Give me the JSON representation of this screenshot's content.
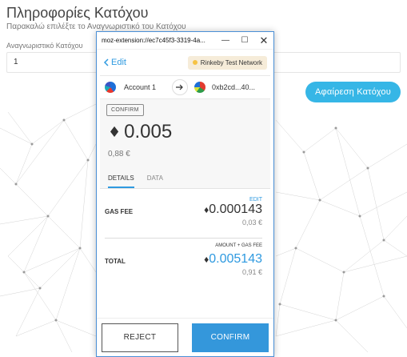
{
  "page": {
    "title": "Πληροφορίες Κατόχου",
    "subtitle": "Παρακαλώ επιλέξτε το Αναγνωριστικό του Κατόχου",
    "field_label": "Αναγνωριστικό Κατόχου",
    "field_value": "1",
    "remove_button": "Αφαίρεση Κατόχου"
  },
  "popup": {
    "window_title": "moz-extension://ec7c45f3-3319-4a...",
    "window_controls": {
      "minimize": "—",
      "maximize": "☐",
      "close": "✕"
    },
    "back_label": "Edit",
    "network": "Rinkeby Test Network",
    "from_account": "Account 1",
    "to_address": "0xb2cd...40...",
    "badge": "CONFIRM",
    "eth_symbol": "♦",
    "amount": "0.005",
    "amount_fiat": "0,88 €",
    "tabs": [
      "DETAILS",
      "DATA"
    ],
    "edit_small": "EDIT",
    "gas_fee_label": "GAS FEE",
    "gas_fee_value": "0.000143",
    "gas_fee_fiat": "0,03 €",
    "amount_gas_label": "AMOUNT + GAS FEE",
    "total_label": "TOTAL",
    "total_value": "0.005143",
    "total_fiat": "0,91 €",
    "reject_label": "REJECT",
    "confirm_label": "CONFIRM"
  },
  "colors": {
    "accent": "#2f9ae0",
    "confirm_bg": "#3497db",
    "remove_bg": "#36b6e6",
    "network_dot": "#f6c343"
  },
  "icons": {
    "back": "chevron-left-icon",
    "transfer": "arrow-right-icon",
    "eth": "ethereum-icon"
  }
}
